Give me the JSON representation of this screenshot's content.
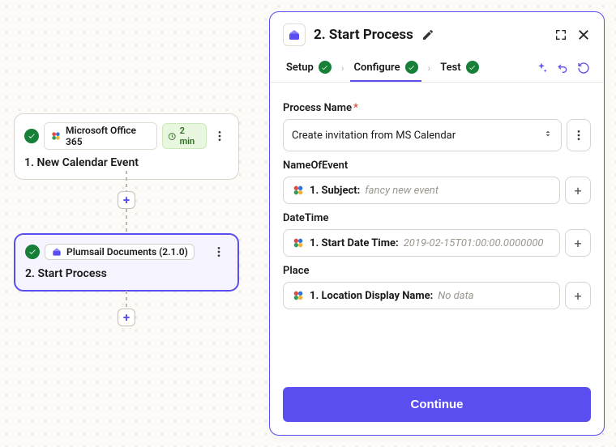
{
  "flow": {
    "node1": {
      "app_label": "Microsoft Office 365",
      "time_label": "2 min",
      "title": "1. New Calendar Event"
    },
    "node2": {
      "app_label": "Plumsail Documents (2.1.0)",
      "title": "2. Start Process"
    }
  },
  "panel": {
    "title": "2. Start Process",
    "tabs": {
      "setup": "Setup",
      "configure": "Configure",
      "test": "Test"
    },
    "process_name": {
      "label": "Process Name",
      "value": "Create invitation from MS Calendar"
    },
    "name_of_event": {
      "label": "NameOfEvent",
      "token_label": "1. Subject:",
      "token_value": "fancy new event"
    },
    "date_time": {
      "label": "DateTime",
      "token_label": "1. Start Date Time:",
      "token_value": "2019-02-15T01:00:00.0000000"
    },
    "place": {
      "label": "Place",
      "token_label": "1. Location Display Name:",
      "token_value": "No data"
    },
    "continue_label": "Continue"
  }
}
